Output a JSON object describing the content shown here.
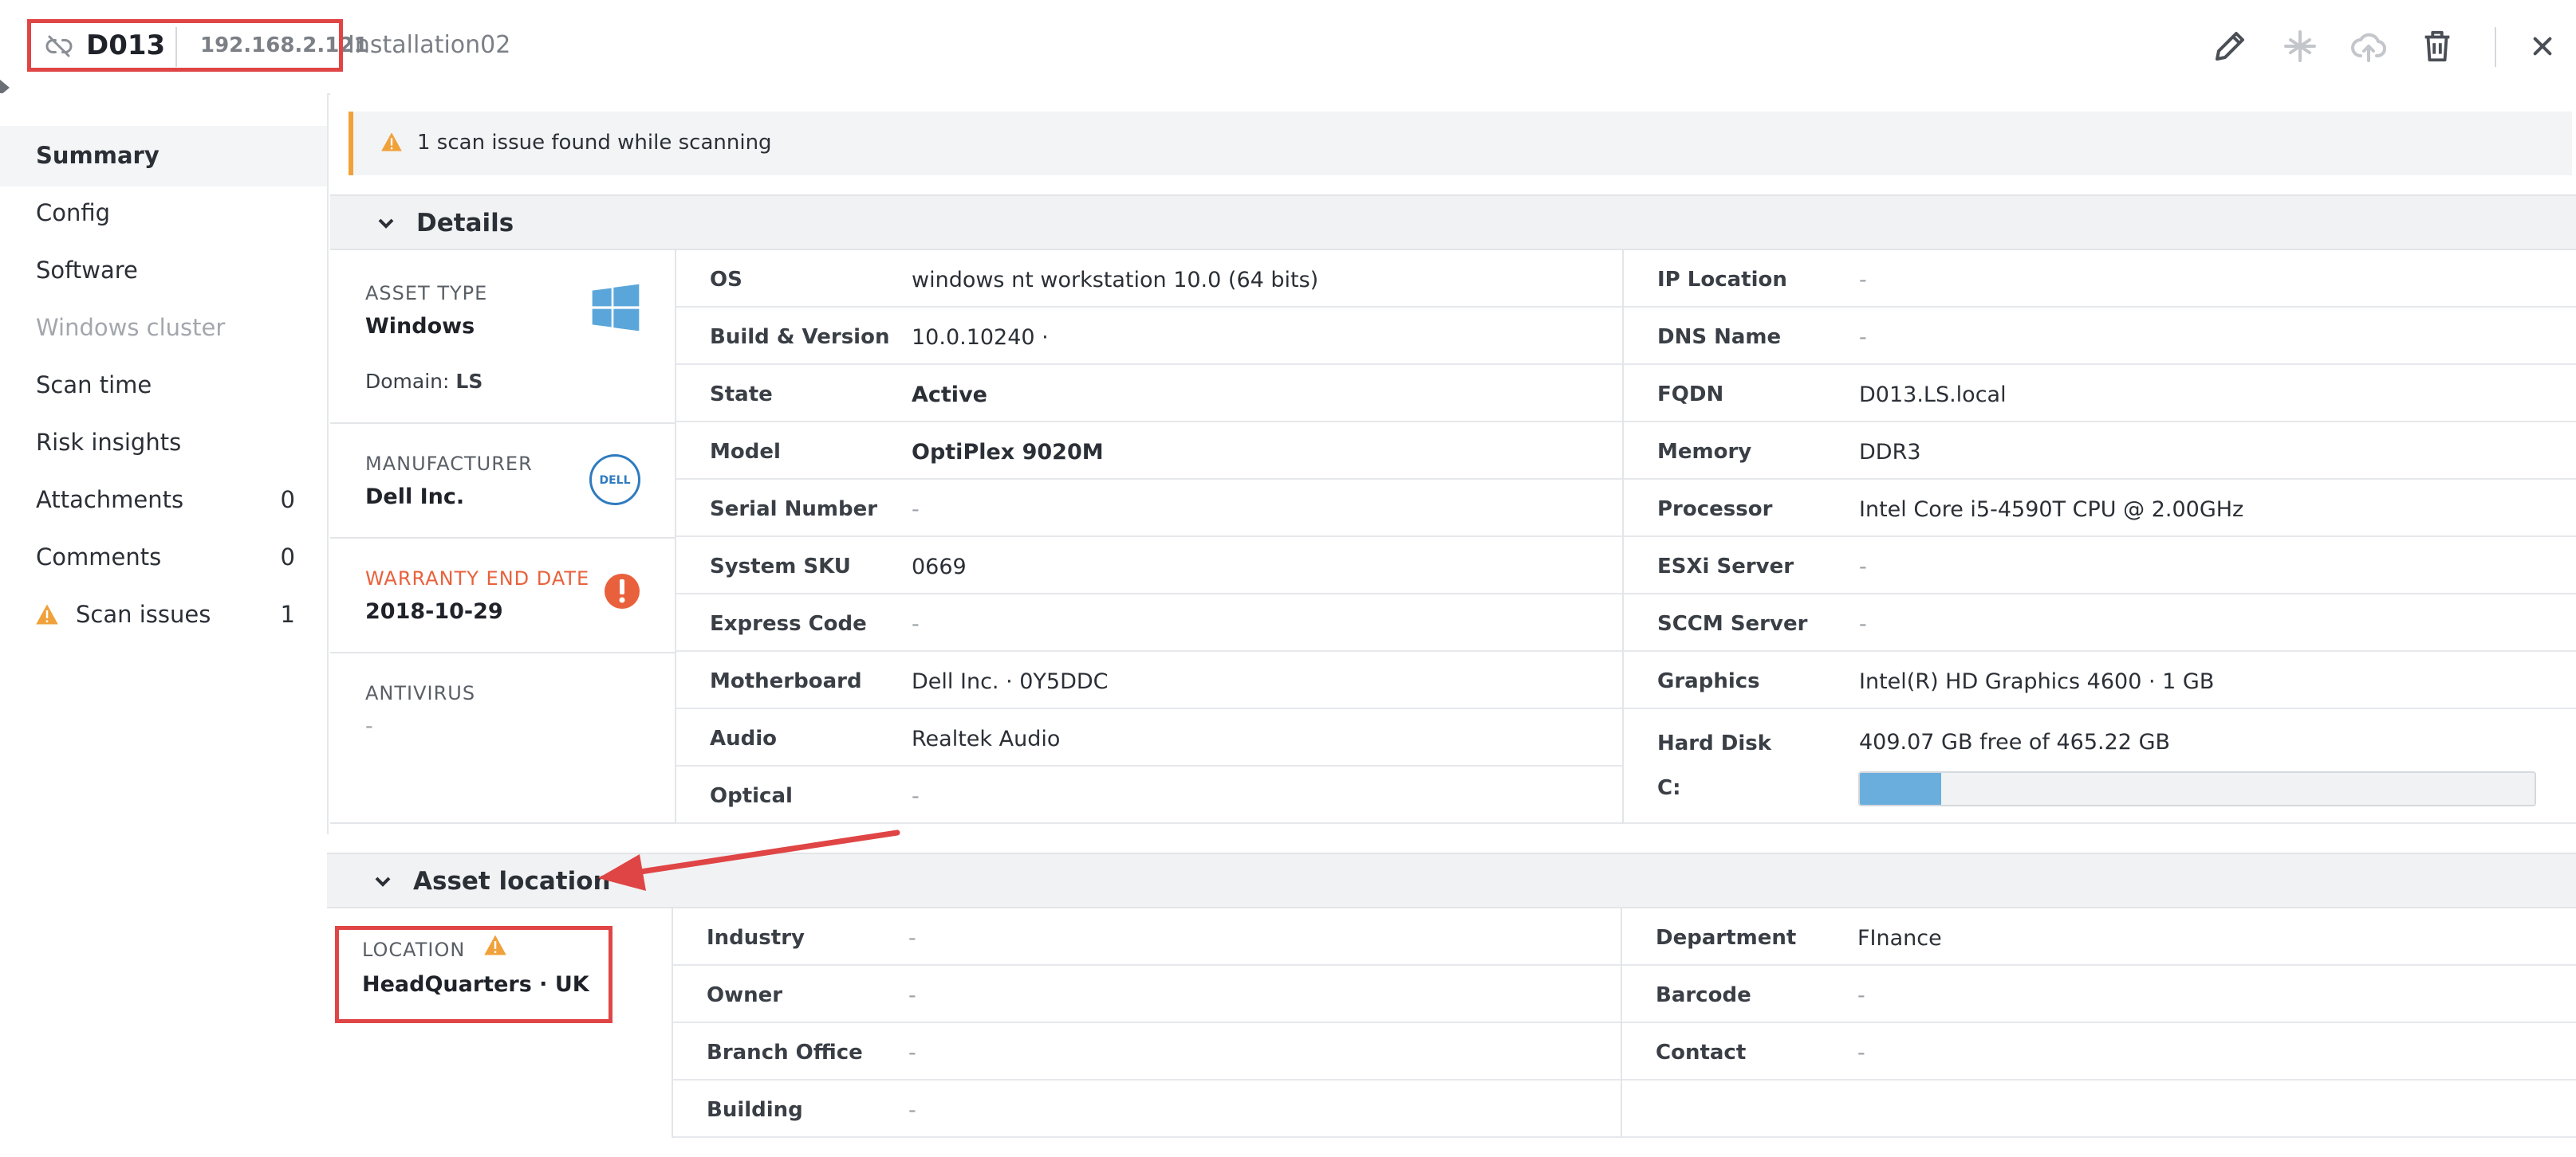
{
  "header": {
    "name": "D013",
    "ip": "192.168.2.121",
    "group": "Installation02",
    "icons": [
      "unlink-icon",
      "pencil-icon",
      "network-icon",
      "cloud-upload-icon",
      "trash-icon",
      "close-icon"
    ]
  },
  "sidebar": {
    "items": [
      {
        "label": "Summary",
        "active": true
      },
      {
        "label": "Config"
      },
      {
        "label": "Software"
      },
      {
        "label": "Windows cluster",
        "disabled": true
      },
      {
        "label": "Scan time"
      },
      {
        "label": "Risk insights"
      },
      {
        "label": "Attachments",
        "count": "0"
      },
      {
        "label": "Comments",
        "count": "0"
      },
      {
        "label": "Scan issues",
        "count": "1",
        "icon": "warning-icon"
      }
    ]
  },
  "alert": {
    "text": "1 scan issue found while scanning",
    "color": "#f0a13a"
  },
  "details": {
    "title": "Details",
    "asset_type_label": "ASSET TYPE",
    "asset_type_value": "Windows",
    "domain_label": "Domain:",
    "domain_value": "LS",
    "manufacturer_label": "MANUFACTURER",
    "manufacturer_value": "Dell Inc.",
    "warranty_label": "WARRANTY END DATE",
    "warranty_value": "2018-10-29",
    "antivirus_label": "ANTIVIRUS",
    "antivirus_value": "-",
    "left_rows": [
      {
        "label": "OS",
        "value": "windows nt workstation 10.0 (64 bits)"
      },
      {
        "label": "Build & Version",
        "value": "10.0.10240 ·"
      },
      {
        "label": "State",
        "value": "Active"
      },
      {
        "label": "Model",
        "value": "OptiPlex 9020M"
      },
      {
        "label": "Serial Number",
        "value": "-"
      },
      {
        "label": "System SKU",
        "value": "0669"
      },
      {
        "label": "Express Code",
        "value": "-"
      },
      {
        "label": "Motherboard",
        "value": "Dell Inc. · 0Y5DDC"
      },
      {
        "label": "Audio",
        "value": "Realtek Audio"
      },
      {
        "label": "Optical",
        "value": "-"
      }
    ],
    "right_rows": [
      {
        "label": "IP Location",
        "value": "-"
      },
      {
        "label": "DNS Name",
        "value": "-"
      },
      {
        "label": "FQDN",
        "value": "D013.LS.local"
      },
      {
        "label": "Memory",
        "value": "DDR3"
      },
      {
        "label": "Processor",
        "value": "Intel Core i5-4590T CPU @ 2.00GHz"
      },
      {
        "label": "ESXi Server",
        "value": "-"
      },
      {
        "label": "SCCM Server",
        "value": "-"
      },
      {
        "label": "Graphics",
        "value": "Intel(R) HD Graphics 4600 · 1 GB"
      }
    ],
    "hard_disk_label": "Hard Disk",
    "hard_disk_value": "409.07 GB free of 465.22 GB",
    "drive_label": "C:",
    "disk_used_fraction": 0.12
  },
  "location": {
    "title": "Asset location",
    "location_label": "LOCATION",
    "location_value": "HeadQuarters · UK",
    "left_rows": [
      {
        "label": "Industry",
        "value": "-"
      },
      {
        "label": "Owner",
        "value": "-"
      },
      {
        "label": "Branch Office",
        "value": "-"
      },
      {
        "label": "Building",
        "value": "-"
      }
    ],
    "right_rows": [
      {
        "label": "Department",
        "value": "FInance"
      },
      {
        "label": "Barcode",
        "value": "-"
      },
      {
        "label": "Contact",
        "value": "-"
      }
    ]
  },
  "colors": {
    "annotation": "#e04545",
    "accent": "#6aaede",
    "warning": "#f0a13a",
    "error": "#e8613c"
  }
}
